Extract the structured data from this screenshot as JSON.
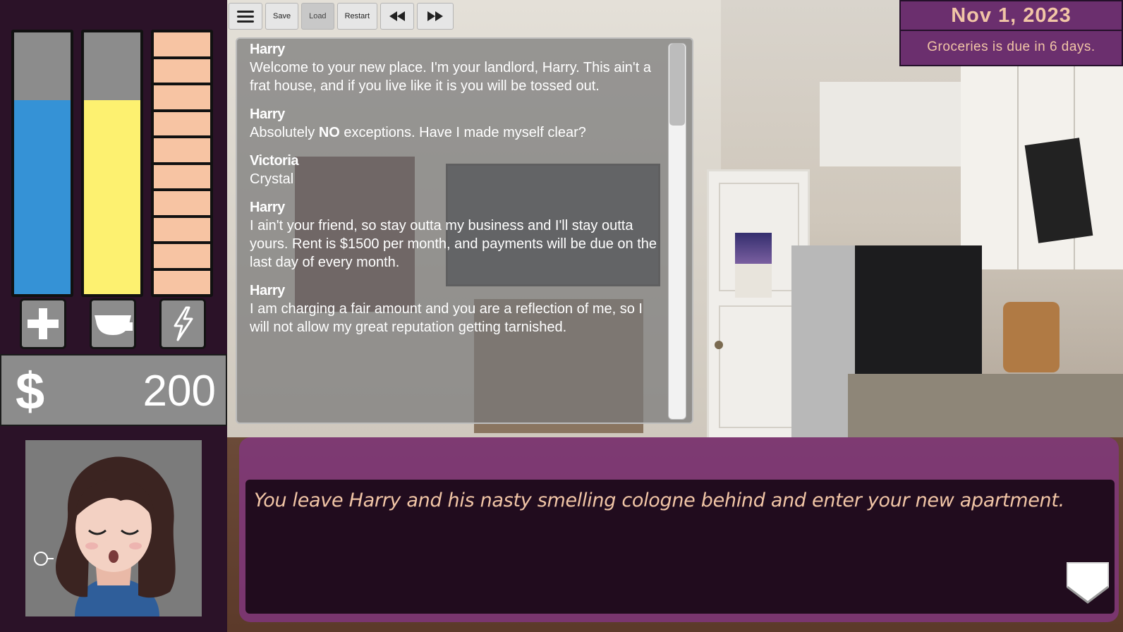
{
  "toolbar": {
    "menu_icon": "hamburger-icon",
    "save": "Save",
    "load": "Load",
    "restart": "Restart",
    "rewind_icon": "rewind-icon",
    "fast_forward_icon": "fast-forward-icon"
  },
  "stats": {
    "health": {
      "level": 0.74,
      "color": "#3592d6",
      "icon": "plus-icon"
    },
    "hunger": {
      "level": 0.74,
      "color": "#fdf170",
      "icon": "food-bowl-icon"
    },
    "energy": {
      "segments_filled": 10,
      "segments_total": 10,
      "color": "#f7c4a3",
      "icon": "lightning-icon"
    }
  },
  "money": {
    "symbol": "$",
    "amount": "200"
  },
  "date": "Nov 1, 2023",
  "due_notice": "Groceries is due in 6 days.",
  "history": [
    {
      "who": "Harry",
      "what": "Welcome to your new place. I'm your landlord, Harry. This ain't a frat house, and if you live like it is you will be tossed out."
    },
    {
      "who": "Harry",
      "what_before": "Absolutely ",
      "what_bold": "NO",
      "what_after": " exceptions. Have I made myself clear?"
    },
    {
      "who": "Victoria",
      "what": "Crystal"
    },
    {
      "who": "Harry",
      "what": "I ain't your friend, so stay outta my business and I'll stay outta yours. Rent is $1500 per month, and payments will be due on the last day of every month."
    },
    {
      "who": "Harry",
      "what": "I am charging a fair amount and you are a reflection of me, so I will not allow my great reputation getting tarnished."
    }
  ],
  "dialogue": {
    "text": "You leave Harry and his nasty smelling cologne behind and enter your new apartment."
  },
  "colors": {
    "panel_purple": "#6b2f6e",
    "accent_peach": "#f1c5a6",
    "dialogue_bg": "#210c1e",
    "sidebar_bg": "#2b1228"
  }
}
